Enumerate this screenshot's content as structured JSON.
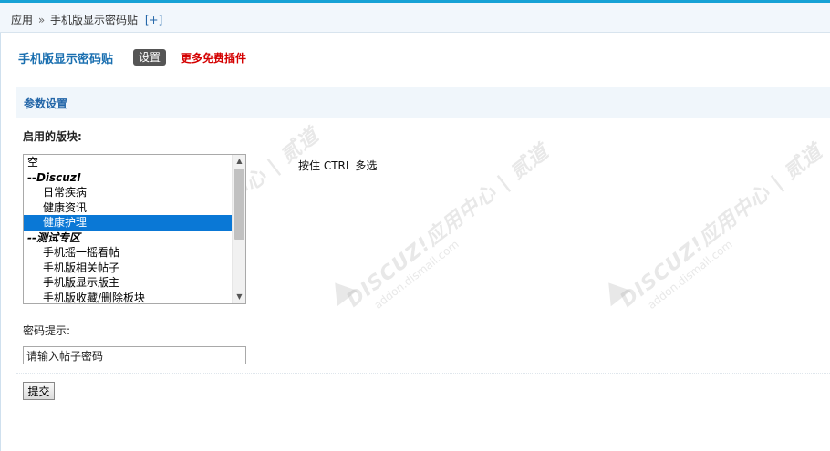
{
  "breadcrumb": {
    "root": "应用",
    "separator": "»",
    "current": "手机版显示密码贴",
    "add": "[+]"
  },
  "plugin": {
    "title": "手机版显示密码贴",
    "tab": "设置",
    "more_link": "更多免费插件"
  },
  "section": {
    "title": "参数设置"
  },
  "forums": {
    "label": "启用的版块:",
    "hint": "按住 CTRL 多选",
    "options": [
      {
        "text": "空",
        "kind": "plain"
      },
      {
        "text": "--Discuz!",
        "kind": "group"
      },
      {
        "text": "日常疾病",
        "kind": "child"
      },
      {
        "text": "健康资讯",
        "kind": "child"
      },
      {
        "text": "健康护理",
        "kind": "child",
        "selected": true
      },
      {
        "text": "--测试专区",
        "kind": "group"
      },
      {
        "text": "手机摇一摇看帖",
        "kind": "child"
      },
      {
        "text": "手机版相关帖子",
        "kind": "child"
      },
      {
        "text": "手机版显示版主",
        "kind": "child"
      },
      {
        "text": "手机版收藏/删除板块",
        "kind": "child"
      }
    ]
  },
  "password": {
    "label": "密码提示:",
    "value": "请输入帖子密码"
  },
  "submit_label": "提交",
  "watermark": {
    "brand": "DISCUZ!应用中心",
    "partner": "贰道",
    "url": "addon.dismall.com"
  },
  "colors": {
    "accent": "#17a2d6",
    "link": "#2366a8",
    "more": "#d40000",
    "selected": "#0a78d6"
  }
}
